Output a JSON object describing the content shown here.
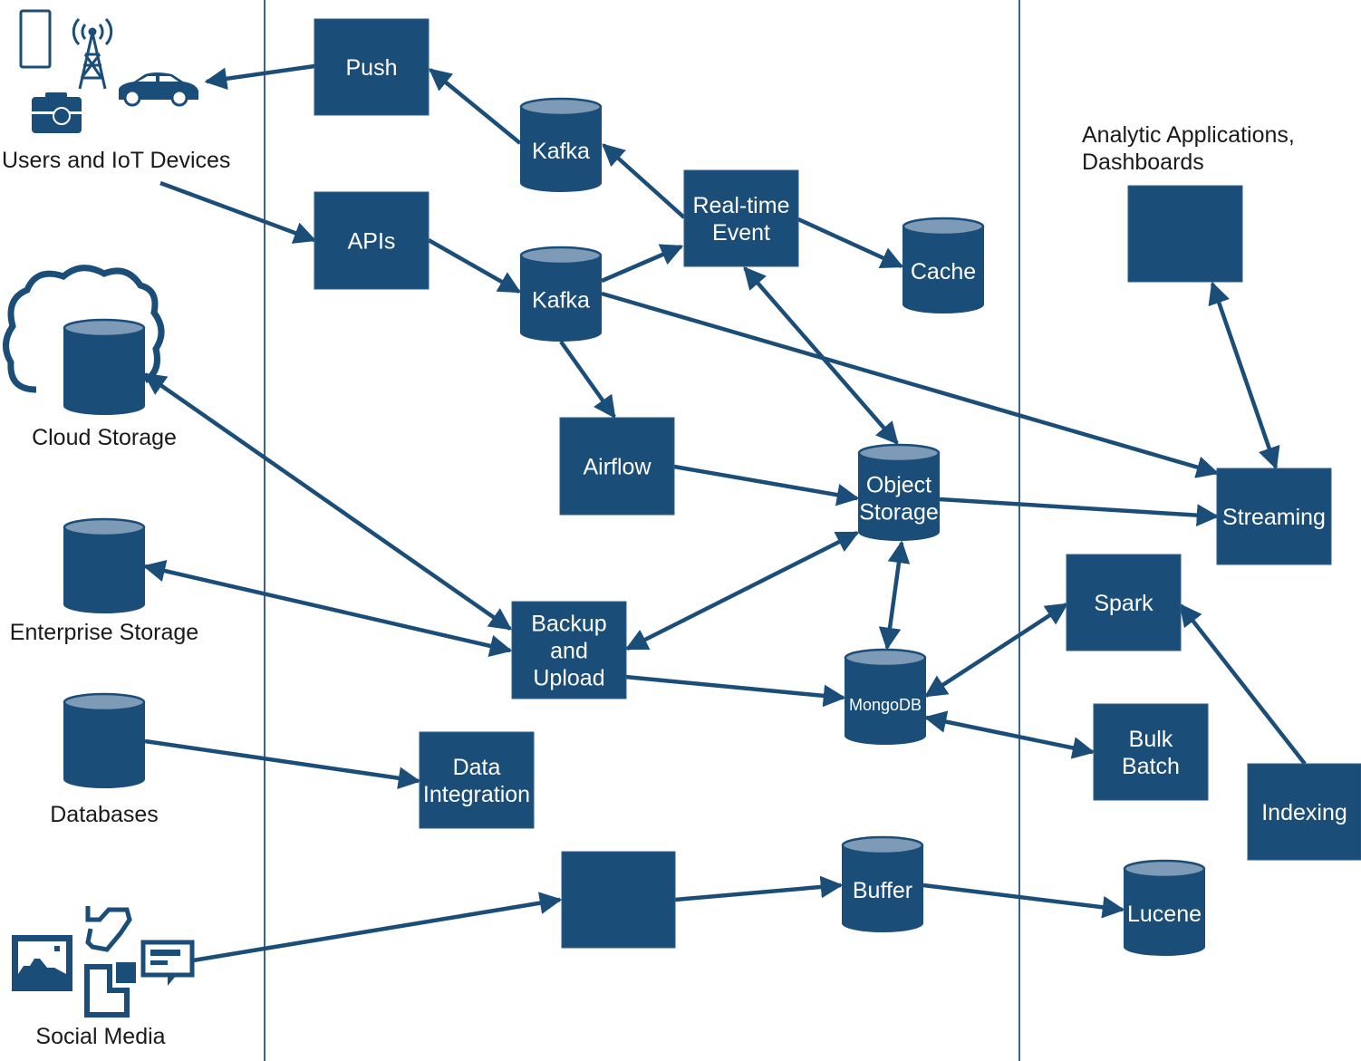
{
  "colors": {
    "node": "#1b4d79",
    "cylinder_top": "#7d9ab6",
    "edge": "#1b4d79",
    "divider": "#3a6390",
    "text": "#1a1a1a"
  },
  "sources": {
    "users_iot": {
      "label": "Users and IoT Devices",
      "icons": [
        "smartphone-icon",
        "cell-tower-icon",
        "car-icon",
        "camera-icon"
      ]
    },
    "cloud_storage": {
      "label": "Cloud Storage",
      "icons": [
        "cloud-icon",
        "database-icon"
      ]
    },
    "enterprise_storage": {
      "label": "Enterprise Storage"
    },
    "databases": {
      "label": "Databases"
    },
    "social_media": {
      "label": "Social Media",
      "icons": [
        "image-icon",
        "map-icon",
        "document-icon",
        "chat-icon"
      ]
    }
  },
  "analytics": {
    "label_line1": "Analytic Applications,",
    "label_line2": "Dashboards"
  },
  "nodes": {
    "push": {
      "shape": "box",
      "lines": [
        "Push"
      ]
    },
    "apis": {
      "shape": "box",
      "lines": [
        "APIs"
      ]
    },
    "kafka1": {
      "shape": "cylinder",
      "lines": [
        "Kafka"
      ]
    },
    "kafka2": {
      "shape": "cylinder",
      "lines": [
        "Kafka"
      ]
    },
    "realtime": {
      "shape": "box",
      "lines": [
        "Real-time",
        "Event"
      ]
    },
    "cache": {
      "shape": "cylinder",
      "lines": [
        "Cache"
      ]
    },
    "airflow": {
      "shape": "box",
      "lines": [
        "Airflow"
      ]
    },
    "object": {
      "shape": "cylinder",
      "lines": [
        "Object",
        "Storage"
      ]
    },
    "backup": {
      "shape": "box",
      "lines": [
        "Backup",
        "and",
        "Upload"
      ]
    },
    "mongodb": {
      "shape": "cylinder",
      "lines": [
        "MongoDB"
      ]
    },
    "dataint": {
      "shape": "box",
      "lines": [
        "Data",
        "Integration"
      ]
    },
    "unnamed": {
      "shape": "box",
      "lines": []
    },
    "buffer": {
      "shape": "cylinder",
      "lines": [
        "Buffer"
      ]
    },
    "lucene": {
      "shape": "cylinder",
      "lines": [
        "Lucene"
      ]
    },
    "dashboard": {
      "shape": "box",
      "lines": []
    },
    "streaming": {
      "shape": "box",
      "lines": [
        "Streaming"
      ]
    },
    "spark": {
      "shape": "box",
      "lines": [
        "Spark"
      ]
    },
    "bulk": {
      "shape": "box",
      "lines": [
        "Bulk",
        "Batch"
      ]
    },
    "indexing": {
      "shape": "box",
      "lines": [
        "Indexing"
      ]
    },
    "cloud_db": {
      "shape": "cylinder",
      "lines": []
    },
    "enterprise_db": {
      "shape": "cylinder",
      "lines": []
    },
    "databases_db": {
      "shape": "cylinder",
      "lines": []
    }
  },
  "edges": [
    {
      "from": "push",
      "to": "users_iot",
      "dir": "forward"
    },
    {
      "from": "kafka1",
      "to": "push",
      "dir": "forward"
    },
    {
      "from": "realtime",
      "to": "kafka1",
      "dir": "forward"
    },
    {
      "from": "users_iot",
      "to": "apis",
      "dir": "forward"
    },
    {
      "from": "apis",
      "to": "kafka2",
      "dir": "forward"
    },
    {
      "from": "kafka2",
      "to": "realtime",
      "dir": "forward"
    },
    {
      "from": "realtime",
      "to": "cache",
      "dir": "forward"
    },
    {
      "from": "kafka2",
      "to": "streaming",
      "dir": "forward"
    },
    {
      "from": "kafka2",
      "to": "airflow",
      "dir": "forward"
    },
    {
      "from": "realtime",
      "to": "object",
      "dir": "both"
    },
    {
      "from": "airflow",
      "to": "object",
      "dir": "forward"
    },
    {
      "from": "object",
      "to": "streaming",
      "dir": "forward"
    },
    {
      "from": "dashboard",
      "to": "streaming",
      "dir": "both"
    },
    {
      "from": "cloud_db",
      "to": "backup",
      "dir": "both"
    },
    {
      "from": "enterprise_db",
      "to": "backup",
      "dir": "both"
    },
    {
      "from": "object",
      "to": "backup",
      "dir": "both"
    },
    {
      "from": "object",
      "to": "mongodb",
      "dir": "both"
    },
    {
      "from": "backup",
      "to": "mongodb",
      "dir": "forward"
    },
    {
      "from": "mongodb",
      "to": "spark",
      "dir": "both"
    },
    {
      "from": "mongodb",
      "to": "bulk",
      "dir": "both"
    },
    {
      "from": "indexing",
      "to": "spark",
      "dir": "forward"
    },
    {
      "from": "databases_db",
      "to": "dataint",
      "dir": "forward"
    },
    {
      "from": "social_media",
      "to": "unnamed",
      "dir": "forward"
    },
    {
      "from": "unnamed",
      "to": "buffer",
      "dir": "forward"
    },
    {
      "from": "buffer",
      "to": "lucene",
      "dir": "forward"
    }
  ]
}
